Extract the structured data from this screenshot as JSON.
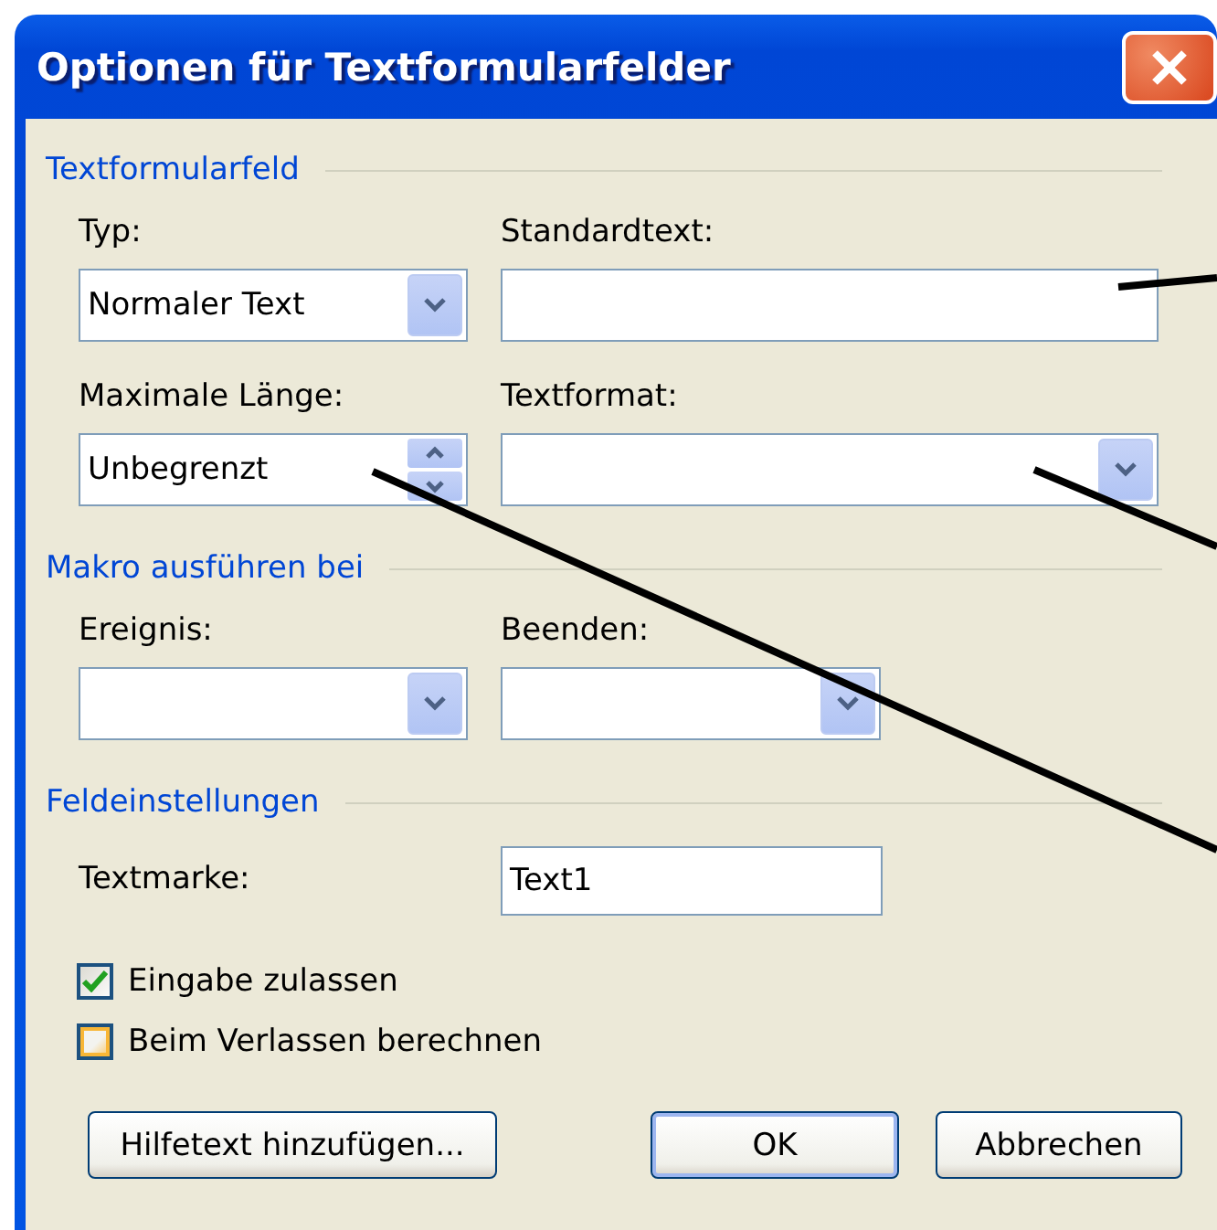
{
  "window": {
    "title": "Optionen für Textformularfelder"
  },
  "groups": [
    {
      "title": "Textformularfeld",
      "rows": [
        [
          {
            "kind": "dropdown",
            "label": "Typ:",
            "value": "Normaler Text"
          },
          {
            "kind": "text",
            "label": "Standardtext:"
          }
        ],
        [
          {
            "kind": "spinner",
            "label": "Maximale Länge:",
            "value": "Unbegrenzt"
          },
          {
            "kind": "dropdown",
            "label": "Textformat:"
          }
        ]
      ]
    },
    {
      "title": "Makro ausführen bei",
      "rows": [
        [
          {
            "kind": "dropdown",
            "label": "Ereignis:"
          },
          {
            "kind": "dropdown",
            "label": "Beenden:"
          }
        ]
      ]
    },
    {
      "title": "Feldeinstellungen",
      "rows": [
        [
          {
            "kind": "inline_text",
            "label": "Textmarke:",
            "value": "Text1"
          }
        ]
      ],
      "checkboxes": [
        {
          "label": "Eingabe zulassen",
          "checked": true,
          "hovered": false
        },
        {
          "label": "Beim Verlassen berechnen",
          "checked": false,
          "hovered": true
        }
      ]
    }
  ],
  "buttons": [
    {
      "label": "Hilfetext hinzufügen...",
      "default": false
    },
    {
      "label": "OK",
      "default": true
    },
    {
      "label": "Abbrechen",
      "default": false
    }
  ]
}
